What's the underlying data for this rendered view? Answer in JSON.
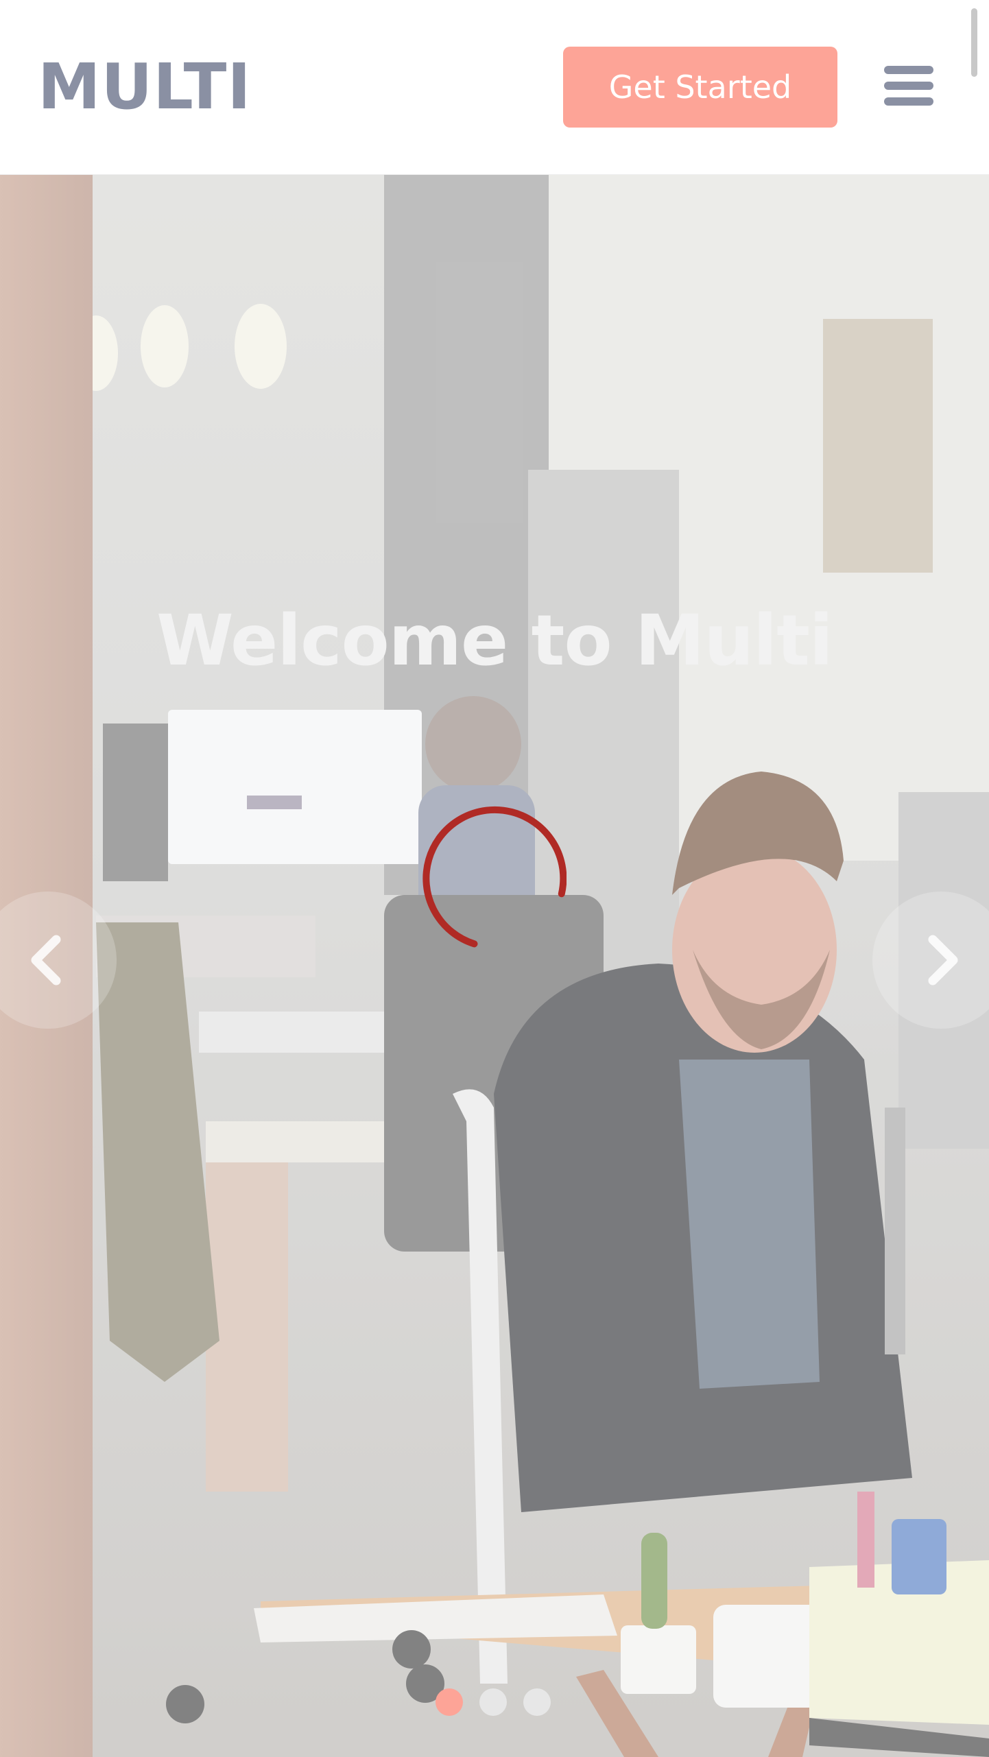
{
  "header": {
    "logo_text": "MULTI",
    "cta_label": "Get Started",
    "menu_icon": "hamburger-menu-icon"
  },
  "hero": {
    "title": "Welcome to Multi",
    "loading_icon": "loading-spinner-icon",
    "prev_icon": "chevron-left-icon",
    "next_icon": "chevron-right-icon",
    "slides": [
      {
        "active": true
      },
      {
        "active": false
      },
      {
        "active": false
      }
    ]
  },
  "colors": {
    "accent": "#fda497",
    "logo": "#8a90a3",
    "spinner": "#b02a25",
    "dot_inactive": "#e7e7e7"
  }
}
